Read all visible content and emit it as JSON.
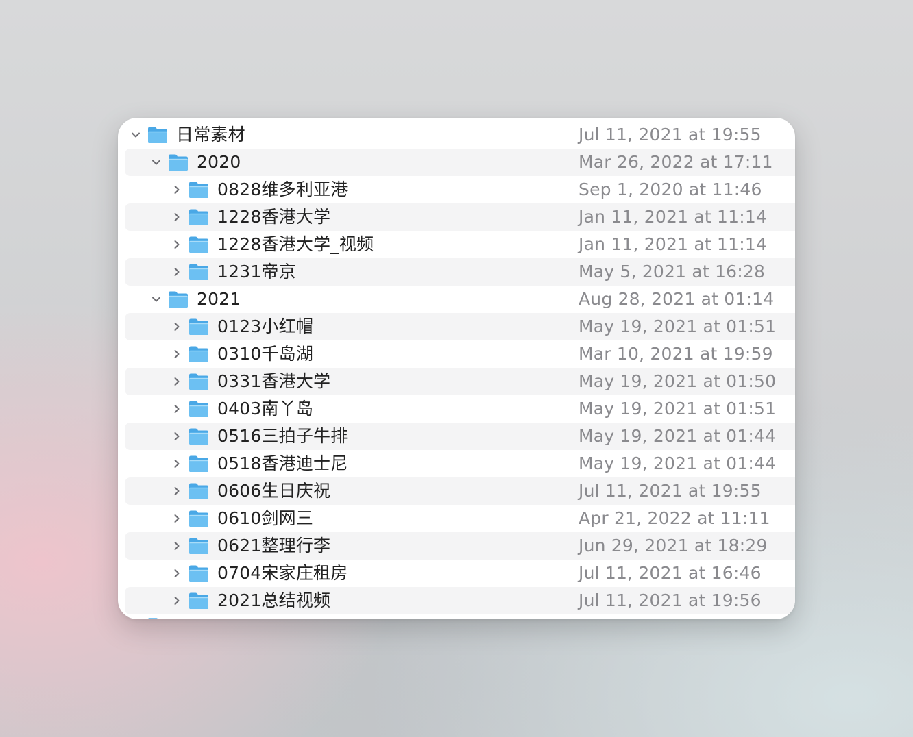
{
  "rows": [
    {
      "name": "日常素材",
      "date": "Jul 11, 2021 at 19:55",
      "level": 0,
      "expanded": true,
      "icon": "folder-icon"
    },
    {
      "name": "2020",
      "date": "Mar 26, 2022 at 17:11",
      "level": 1,
      "expanded": true,
      "icon": "folder-icon"
    },
    {
      "name": "0828维多利亚港",
      "date": "Sep 1, 2020 at 11:46",
      "level": 2,
      "expanded": false,
      "icon": "folder-icon"
    },
    {
      "name": "1228香港大学",
      "date": "Jan 11, 2021 at 11:14",
      "level": 2,
      "expanded": false,
      "icon": "folder-icon"
    },
    {
      "name": "1228香港大学_视频",
      "date": "Jan 11, 2021 at 11:14",
      "level": 2,
      "expanded": false,
      "icon": "folder-icon"
    },
    {
      "name": "1231帝京",
      "date": "May 5, 2021 at 16:28",
      "level": 2,
      "expanded": false,
      "icon": "folder-icon"
    },
    {
      "name": "2021",
      "date": "Aug 28, 2021 at 01:14",
      "level": 1,
      "expanded": true,
      "icon": "folder-icon"
    },
    {
      "name": "0123小红帽",
      "date": "May 19, 2021 at 01:51",
      "level": 2,
      "expanded": false,
      "icon": "folder-icon"
    },
    {
      "name": "0310千岛湖",
      "date": "Mar 10, 2021 at 19:59",
      "level": 2,
      "expanded": false,
      "icon": "folder-icon"
    },
    {
      "name": "0331香港大学",
      "date": "May 19, 2021 at 01:50",
      "level": 2,
      "expanded": false,
      "icon": "folder-icon"
    },
    {
      "name": "0403南丫岛",
      "date": "May 19, 2021 at 01:51",
      "level": 2,
      "expanded": false,
      "icon": "folder-icon"
    },
    {
      "name": "0516三拍子牛排",
      "date": "May 19, 2021 at 01:44",
      "level": 2,
      "expanded": false,
      "icon": "folder-icon"
    },
    {
      "name": "0518香港迪士尼",
      "date": "May 19, 2021 at 01:44",
      "level": 2,
      "expanded": false,
      "icon": "folder-icon"
    },
    {
      "name": "0606生日庆祝",
      "date": "Jul 11, 2021 at 19:55",
      "level": 2,
      "expanded": false,
      "icon": "folder-icon"
    },
    {
      "name": "0610剑网三",
      "date": "Apr 21, 2022 at 11:11",
      "level": 2,
      "expanded": false,
      "icon": "folder-icon"
    },
    {
      "name": "0621整理行李",
      "date": "Jun 29, 2021 at 18:29",
      "level": 2,
      "expanded": false,
      "icon": "folder-icon"
    },
    {
      "name": "0704宋家庄租房",
      "date": "Jul 11, 2021 at 16:46",
      "level": 2,
      "expanded": false,
      "icon": "folder-icon"
    },
    {
      "name": "2021总结视频",
      "date": "Jul 11, 2021 at 19:56",
      "level": 2,
      "expanded": false,
      "icon": "folder-icon"
    }
  ],
  "colors": {
    "folder_front": "#6cc0f2",
    "folder_back": "#4aa8e6",
    "name_text": "#222222",
    "date_text": "#8a8a8e",
    "alt_row": "#f4f4f5"
  }
}
